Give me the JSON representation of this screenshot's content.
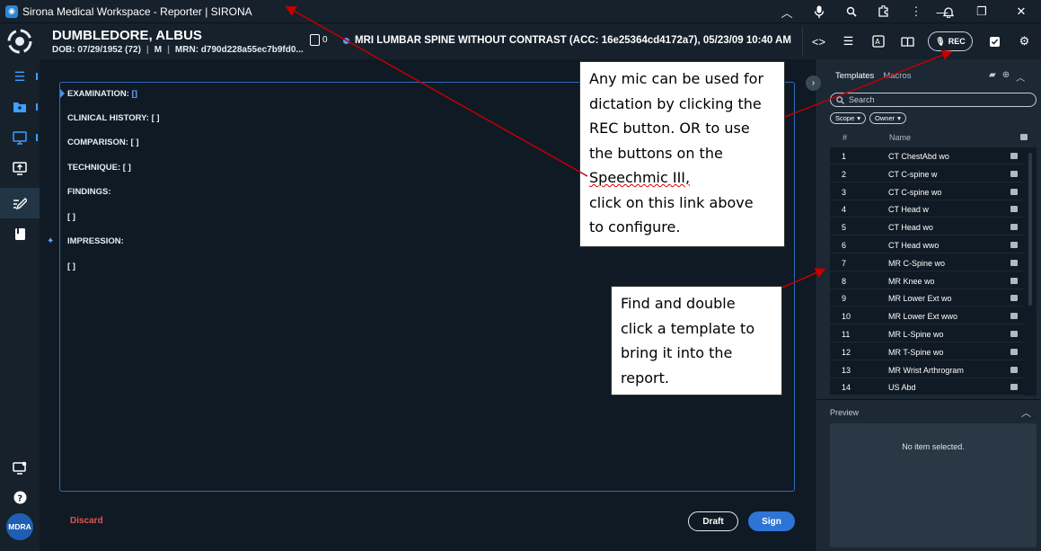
{
  "window": {
    "title": "Sirona Medical Workspace - Reporter | SIRONA",
    "icons": [
      "chevron-up-icon",
      "microphone-icon",
      "zoom-icon",
      "extension-icon",
      "more-vert-icon",
      "bell-icon"
    ],
    "controls": [
      "minimize",
      "restore",
      "close"
    ]
  },
  "header": {
    "patient_name": "DUMBLEDORE, ALBUS",
    "dob": "DOB: 07/29/1952 (72)",
    "sex": "M",
    "mrn": "MRN: d790d228a55ec7b9fd0...",
    "document_count": "0",
    "exam": "MRI LUMBAR SPINE WITHOUT CONTRAST (ACC: 16e25364cd4172a7), 05/23/09 10:40 AM",
    "rec_label": "REC"
  },
  "leftnav": {
    "items": [
      "worklist",
      "patient-folder",
      "viewer",
      "screen-share",
      "reporter",
      "notes"
    ],
    "active": "reporter",
    "avatar_initials": "MDRA"
  },
  "report": {
    "sections": [
      {
        "label": "EXAMINATION:",
        "value": "[]"
      },
      {
        "label": "CLINICAL HISTORY:",
        "value": "[ ]"
      },
      {
        "label": "COMPARISON:",
        "value": "[ ]"
      },
      {
        "label": "TECHNIQUE:",
        "value": "[ ]"
      },
      {
        "label": "FINDINGS:",
        "value": ""
      },
      {
        "label": "",
        "value": "[ ]"
      },
      {
        "label": "IMPRESSION:",
        "value": ""
      },
      {
        "label": "",
        "value": "[ ]"
      }
    ],
    "discard_label": "Discard",
    "draft_label": "Draft",
    "sign_label": "Sign"
  },
  "panel": {
    "tabs": [
      "Templates",
      "Macros"
    ],
    "active_tab": "Templates",
    "search_placeholder": "Search",
    "filters": [
      "Scope",
      "Owner"
    ],
    "columns": [
      "#",
      "Name"
    ],
    "templates": [
      {
        "num": "1",
        "name": "CT ChestAbd wo"
      },
      {
        "num": "2",
        "name": "CT C-spine w"
      },
      {
        "num": "3",
        "name": "CT C-spine wo"
      },
      {
        "num": "4",
        "name": "CT Head w"
      },
      {
        "num": "5",
        "name": "CT Head wo"
      },
      {
        "num": "6",
        "name": "CT Head wwo"
      },
      {
        "num": "7",
        "name": "MR C-Spine wo"
      },
      {
        "num": "8",
        "name": "MR Knee wo"
      },
      {
        "num": "9",
        "name": "MR Lower Ext wo"
      },
      {
        "num": "10",
        "name": "MR Lower Ext wwo"
      },
      {
        "num": "11",
        "name": "MR L-Spine wo"
      },
      {
        "num": "12",
        "name": "MR T-Spine wo"
      },
      {
        "num": "13",
        "name": "MR Wrist Arthrogram"
      },
      {
        "num": "14",
        "name": "US Abd"
      }
    ],
    "preview_label": "Preview",
    "preview_empty": "No item selected."
  },
  "callouts": {
    "mic_lines": [
      "Any mic can be used for",
      "dictation by clicking the",
      "REC button. OR to use",
      "the buttons on the",
      "Speechmic III,",
      "click on this link above",
      "to configure."
    ],
    "template_lines": [
      "Find and double",
      "click a template to",
      "bring it into the",
      "report."
    ]
  },
  "colors": {
    "accent": "#2e74d6",
    "link": "#3fa0ff",
    "discard": "#e5534b",
    "arrow": "#c00000"
  }
}
